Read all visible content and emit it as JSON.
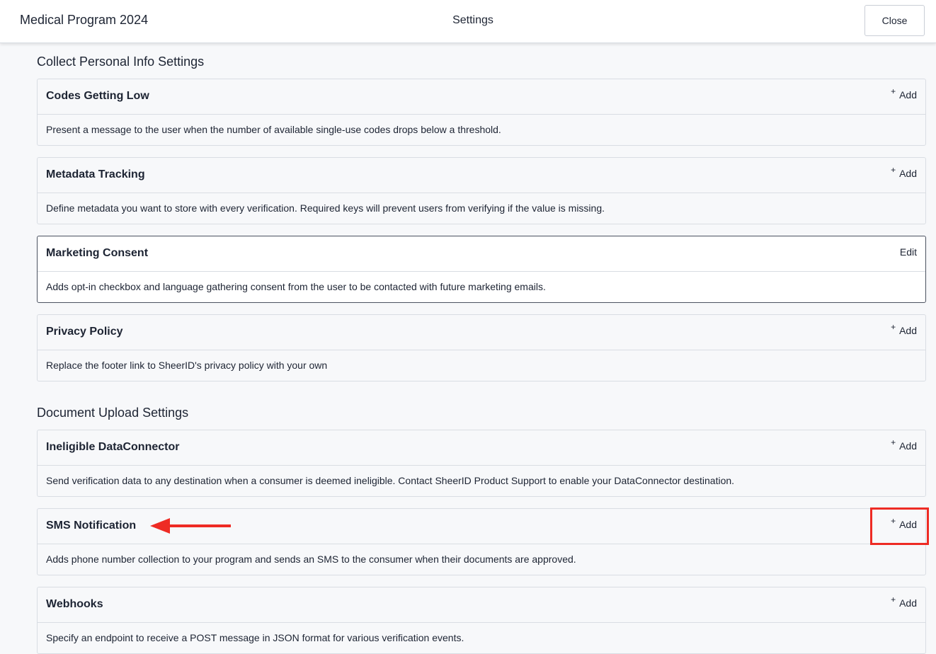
{
  "header": {
    "program_name": "Medical Program 2024",
    "page_title": "Settings",
    "close_label": "Close"
  },
  "sections": [
    {
      "title": "Collect Personal Info Settings",
      "cards": [
        {
          "title": "Codes Getting Low",
          "action": "Add",
          "description": "Present a message to the user when the number of available single-use codes drops below a threshold."
        },
        {
          "title": "Metadata Tracking",
          "action": "Add",
          "description": "Define metadata you want to store with every verification. Required keys will prevent users from verifying if the value is missing."
        },
        {
          "title": "Marketing Consent",
          "action": "Edit",
          "description": "Adds opt-in checkbox and language gathering consent from the user to be contacted with future marketing emails."
        },
        {
          "title": "Privacy Policy",
          "action": "Add",
          "description": "Replace the footer link to SheerID's privacy policy with your own"
        }
      ]
    },
    {
      "title": "Document Upload Settings",
      "cards": [
        {
          "title": "Ineligible DataConnector",
          "action": "Add",
          "description": "Send verification data to any destination when a consumer is deemed ineligible. Contact SheerID Product Support to enable your DataConnector destination."
        },
        {
          "title": "SMS Notification",
          "action": "Add",
          "description": "Adds phone number collection to your program and sends an SMS to the consumer when their documents are approved."
        },
        {
          "title": "Webhooks",
          "action": "Add",
          "description": "Specify an endpoint to receive a POST message in JSON format for various verification events."
        }
      ]
    }
  ],
  "icons": {
    "plus": "+"
  },
  "annotation_colors": {
    "highlight": "#ee2b24"
  }
}
